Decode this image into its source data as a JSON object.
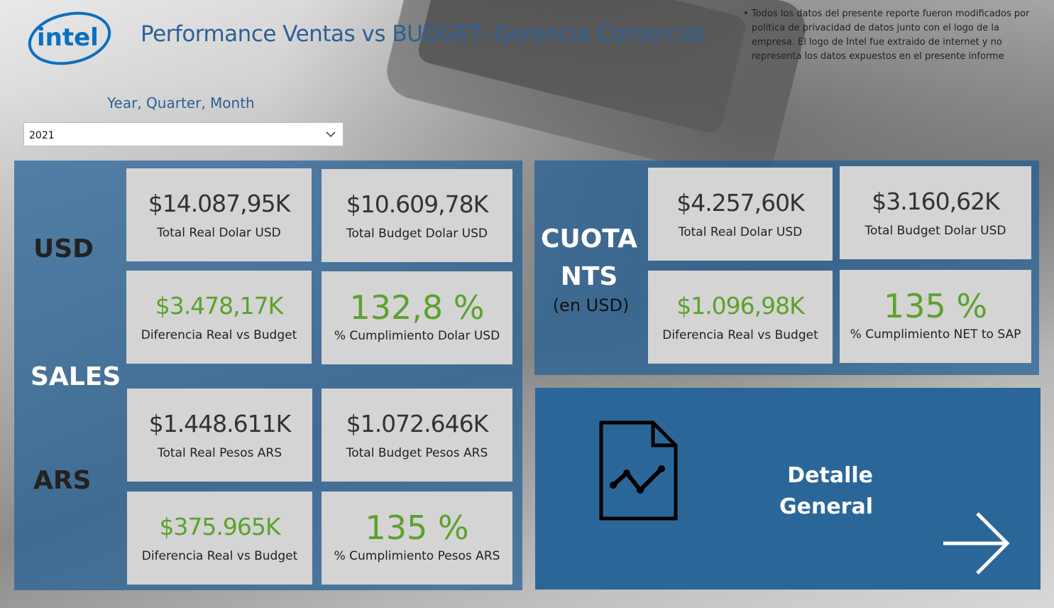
{
  "header": {
    "logo_text": "intel",
    "title": "Performance Ventas vs BUDGET- Gerencia Comercial",
    "disclaimer": "Todos los datos del presente reporte fueron modificados por politica de privacidad de datos junto con el logo de la empresa. El logo de Intel fue extraido de internet y no representa los datos expuestos en el presente informe"
  },
  "filter": {
    "label": "Year, Quarter, Month",
    "selected": "2021"
  },
  "sales": {
    "usd_label": "USD",
    "sales_label": "SALES",
    "ars_label": "ARS",
    "cards": [
      {
        "value": "$14.087,95K",
        "label": "Total Real Dolar USD"
      },
      {
        "value": "$10.609,78K",
        "label": "Total Budget Dolar USD"
      },
      {
        "value": "$3.478,17K",
        "label": "Diferencia Real vs Budget"
      },
      {
        "value": "132,8 %",
        "label": "% Cumplimiento Dolar USD"
      },
      {
        "value": "$1.448.611K",
        "label": "Total Real Pesos ARS"
      },
      {
        "value": "$1.072.646K",
        "label": "Total Budget Pesos ARS"
      },
      {
        "value": "$375.965K",
        "label": "Diferencia Real vs Budget"
      },
      {
        "value": "135 %",
        "label": "% Cumplimiento Pesos ARS"
      }
    ]
  },
  "cuota": {
    "label": "CUOTA NTS",
    "label_line1": "CUOTA",
    "label_line2": "NTS",
    "sub": "(en USD)",
    "cards": [
      {
        "value": "$4.257,60K",
        "label": "Total Real Dolar USD"
      },
      {
        "value": "$3.160,62K",
        "label": "Total Budget Dolar USD"
      },
      {
        "value": "$1.096,98K",
        "label": "Diferencia Real vs Budget"
      },
      {
        "value": "135 %",
        "label": "% Cumplimiento NET to SAP"
      }
    ]
  },
  "nav": {
    "detalle_line1": "Detalle",
    "detalle_line2": "General"
  },
  "colors": {
    "brand_blue": "#2d5f97",
    "panel_blue": "#2b6699",
    "positive_green": "#5da12d",
    "card_gray": "#d4d4d4"
  },
  "icons": [
    "intel-logo",
    "chevron-down-icon",
    "document-chart-icon",
    "arrow-right-icon"
  ]
}
